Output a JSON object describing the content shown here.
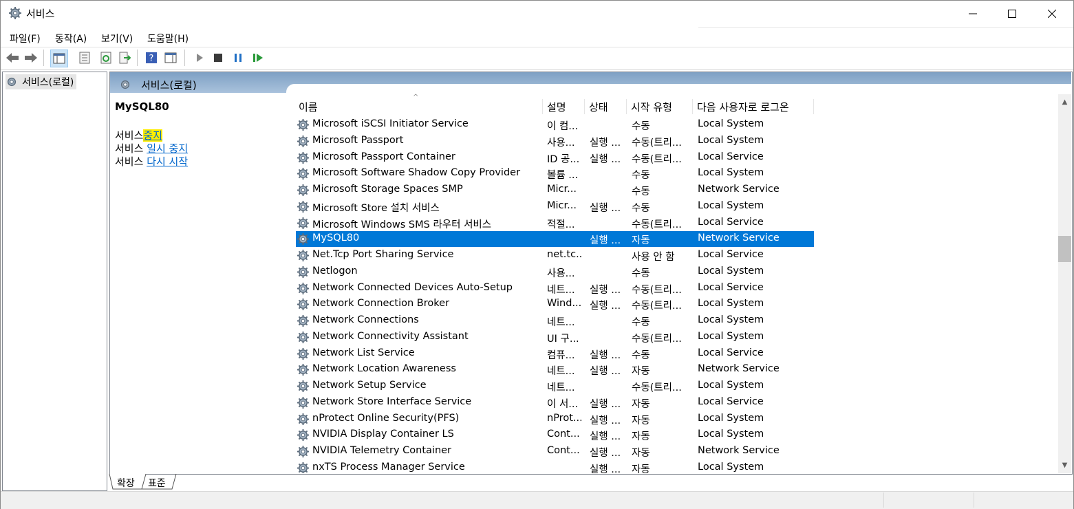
{
  "window": {
    "title": "서비스",
    "icon": "gear-icon"
  },
  "menu": [
    "파일(F)",
    "동작(A)",
    "보기(V)",
    "도움말(H)"
  ],
  "tree": {
    "root_label": "서비스(로컬)"
  },
  "main": {
    "header_title": "서비스(로컬)",
    "detail": {
      "service_name": "MySQL80",
      "prefix": "서비스",
      "stop_label": "중지",
      "pause_label": "일시 중지",
      "restart_label": "다시 시작"
    }
  },
  "table": {
    "columns": [
      "이름",
      "설명",
      "상태",
      "시작 유형",
      "다음 사용자로 로그온"
    ],
    "rows": [
      {
        "name": "Microsoft iSCSI Initiator Service",
        "desc": "이 컴...",
        "state": "",
        "start": "수동",
        "logon": "Local System"
      },
      {
        "name": "Microsoft Passport",
        "desc": "사용...",
        "state": "실행 ...",
        "start": "수동(트리...",
        "logon": "Local System"
      },
      {
        "name": "Microsoft Passport Container",
        "desc": "ID 공...",
        "state": "실행 ...",
        "start": "수동(트리...",
        "logon": "Local Service"
      },
      {
        "name": "Microsoft Software Shadow Copy Provider",
        "desc": "볼륨 ...",
        "state": "",
        "start": "수동",
        "logon": "Local System"
      },
      {
        "name": "Microsoft Storage Spaces SMP",
        "desc": "Micr...",
        "state": "",
        "start": "수동",
        "logon": "Network Service"
      },
      {
        "name": "Microsoft Store 설치 서비스",
        "desc": "Micr...",
        "state": "실행 ...",
        "start": "수동",
        "logon": "Local System"
      },
      {
        "name": "Microsoft Windows SMS 라우터 서비스",
        "desc": "적절...",
        "state": "",
        "start": "수동(트리...",
        "logon": "Local Service"
      },
      {
        "name": "MySQL80",
        "desc": "",
        "state": "실행 ...",
        "start": "자동",
        "logon": "Network Service",
        "selected": true
      },
      {
        "name": "Net.Tcp Port Sharing Service",
        "desc": "net.tc...",
        "state": "",
        "start": "사용 안 함",
        "logon": "Local Service"
      },
      {
        "name": "Netlogon",
        "desc": "사용...",
        "state": "",
        "start": "수동",
        "logon": "Local System"
      },
      {
        "name": "Network Connected Devices Auto-Setup",
        "desc": "네트...",
        "state": "실행 ...",
        "start": "수동(트리...",
        "logon": "Local Service"
      },
      {
        "name": "Network Connection Broker",
        "desc": "Wind...",
        "state": "실행 ...",
        "start": "수동(트리...",
        "logon": "Local System"
      },
      {
        "name": "Network Connections",
        "desc": "네트...",
        "state": "",
        "start": "수동",
        "logon": "Local System"
      },
      {
        "name": "Network Connectivity Assistant",
        "desc": "UI 구...",
        "state": "",
        "start": "수동(트리...",
        "logon": "Local System"
      },
      {
        "name": "Network List Service",
        "desc": "컴퓨...",
        "state": "실행 ...",
        "start": "수동",
        "logon": "Local Service"
      },
      {
        "name": "Network Location Awareness",
        "desc": "네트...",
        "state": "실행 ...",
        "start": "자동",
        "logon": "Network Service"
      },
      {
        "name": "Network Setup Service",
        "desc": "네트...",
        "state": "",
        "start": "수동(트리...",
        "logon": "Local System"
      },
      {
        "name": "Network Store Interface Service",
        "desc": "이 서...",
        "state": "실행 ...",
        "start": "자동",
        "logon": "Local Service"
      },
      {
        "name": "nProtect Online Security(PFS)",
        "desc": "nProt...",
        "state": "실행 ...",
        "start": "자동",
        "logon": "Local System"
      },
      {
        "name": "NVIDIA Display Container LS",
        "desc": "Cont...",
        "state": "실행 ...",
        "start": "자동",
        "logon": "Local System"
      },
      {
        "name": "NVIDIA Telemetry Container",
        "desc": "Cont...",
        "state": "실행 ...",
        "start": "자동",
        "logon": "Network Service"
      },
      {
        "name": "nxTS Process Manager Service",
        "desc": "",
        "state": "실행 ...",
        "start": "자동",
        "logon": "Local System"
      }
    ]
  },
  "bottom_tabs": [
    "확장",
    "표준"
  ],
  "colors": {
    "selection": "#0078d7",
    "link": "#0066cc",
    "highlight": "#ffee00",
    "header_band": "#a9c2dc"
  }
}
